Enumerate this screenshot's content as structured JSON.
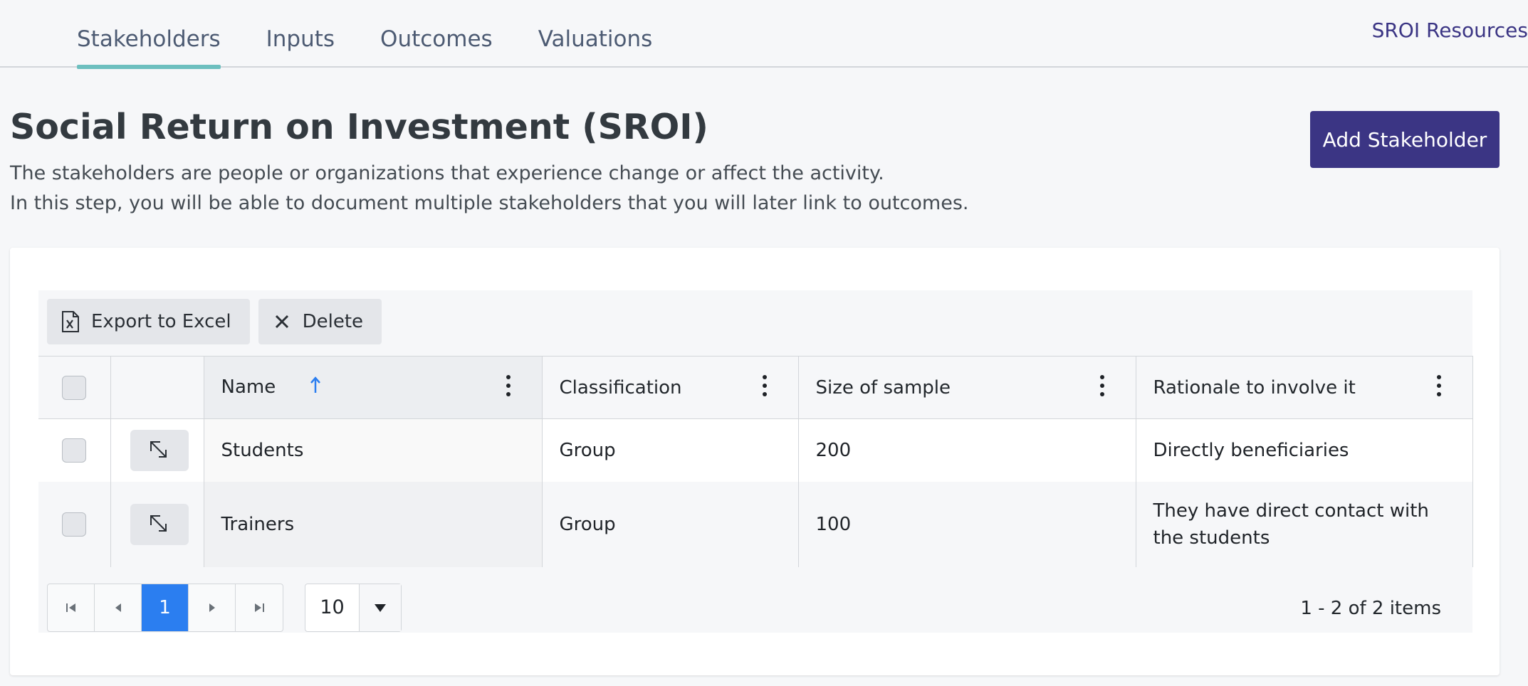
{
  "nav": {
    "tabs": [
      {
        "label": "Stakeholders",
        "active": true
      },
      {
        "label": "Inputs",
        "active": false
      },
      {
        "label": "Outcomes",
        "active": false
      },
      {
        "label": "Valuations",
        "active": false
      }
    ],
    "resources_link": "SROI Resources"
  },
  "header": {
    "title": "Social Return on Investment (SROI)",
    "description_line1": "The stakeholders are people or organizations that experience change or affect the activity.",
    "description_line2": "In this step, you will be able to document multiple stakeholders that you will later link to outcomes.",
    "add_button": "Add Stakeholder"
  },
  "toolbar": {
    "export_label": "Export to Excel",
    "delete_label": "Delete"
  },
  "grid": {
    "columns": [
      "Name",
      "Classification",
      "Size of sample",
      "Rationale to involve it"
    ],
    "sorted_column": "Name",
    "sort_direction": "ascending",
    "rows": [
      {
        "name": "Students",
        "classification": "Group",
        "size": "200",
        "rationale": "Directly beneficiaries"
      },
      {
        "name": "Trainers",
        "classification": "Group",
        "size": "100",
        "rationale": "They have direct contact with the students"
      }
    ]
  },
  "pager": {
    "current_page": "1",
    "page_size": "10",
    "info": "1 - 2 of 2 items"
  },
  "colors": {
    "brand": "#3b3584",
    "active_tab_underline": "#6dbfbf",
    "page_active": "#2b7ef0"
  }
}
